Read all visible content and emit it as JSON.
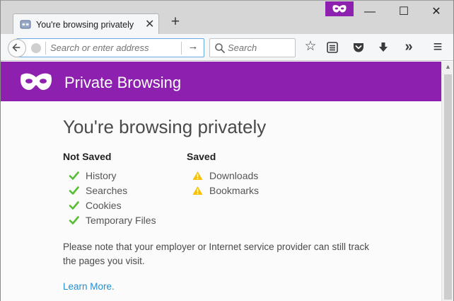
{
  "window": {
    "private_badge_icon": "private-mask-icon",
    "controls": {
      "minimize": "—",
      "maximize": "☐",
      "close": "✕"
    }
  },
  "tab": {
    "title": "You're browsing privately",
    "close": "✕",
    "new_tab": "+"
  },
  "toolbar": {
    "back_icon": "back-arrow-icon",
    "url_placeholder": "Search or enter address",
    "go_icon": "→",
    "search_placeholder": "Search",
    "bookmark_star": "☆",
    "more_tools": "»",
    "menu": "≡"
  },
  "page": {
    "header_title": "Private Browsing",
    "heading": "You're browsing privately",
    "not_saved": {
      "title": "Not Saved",
      "items": [
        "History",
        "Searches",
        "Cookies",
        "Temporary Files"
      ]
    },
    "saved": {
      "title": "Saved",
      "items": [
        "Downloads",
        "Bookmarks"
      ]
    },
    "note": "Please note that your employer or Internet service provider can still track the pages you visit.",
    "learn_more": "Learn More."
  },
  "colors": {
    "accent_purple": "#8d20ae",
    "check_green": "#57bd35",
    "warning_yellow": "#f5c100",
    "link_blue": "#1f8fd4"
  }
}
